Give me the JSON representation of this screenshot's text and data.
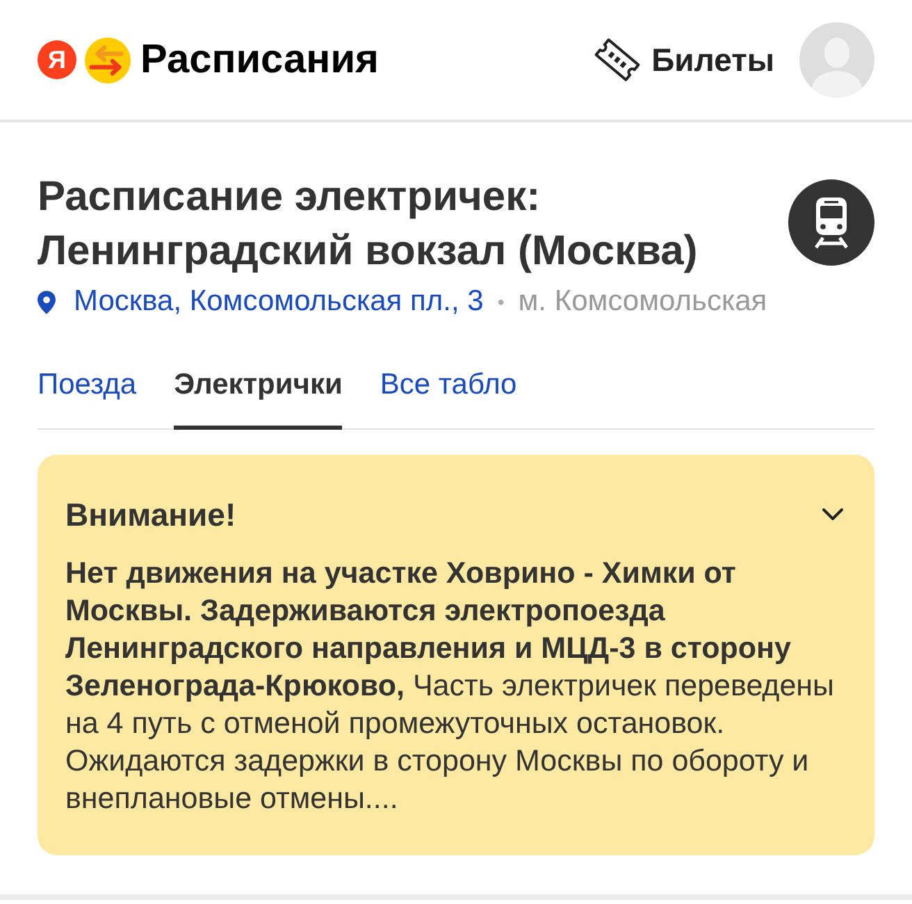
{
  "header": {
    "logo": {
      "letter": "Я",
      "service": "Расписания"
    },
    "tickets_link": "Билеты"
  },
  "station": {
    "title": "Расписание электричек: Ленинградский вокзал (Москва)",
    "address": "Москва, Комсомольская пл., 3",
    "separator": "•",
    "metro": "м. Комсомольская"
  },
  "tabs": [
    {
      "label": "Поезда",
      "selected": false
    },
    {
      "label": "Электрички",
      "selected": true
    },
    {
      "label": "Все табло",
      "selected": false
    }
  ],
  "alert": {
    "title": "Внимание!",
    "expanded": false,
    "text": "**Нет движения на участке Ховрино - Химки от Москвы. Задерживаются электропоезда Ленинградского направления и МЦД-3 в сторону Зеленограда-Крюково,** Часть электричек переведены на 4 путь с отменой промежуточных остановок. Ожидаются задержки в сторону Москвы по обороту и внеплановые отмены...."
  }
}
